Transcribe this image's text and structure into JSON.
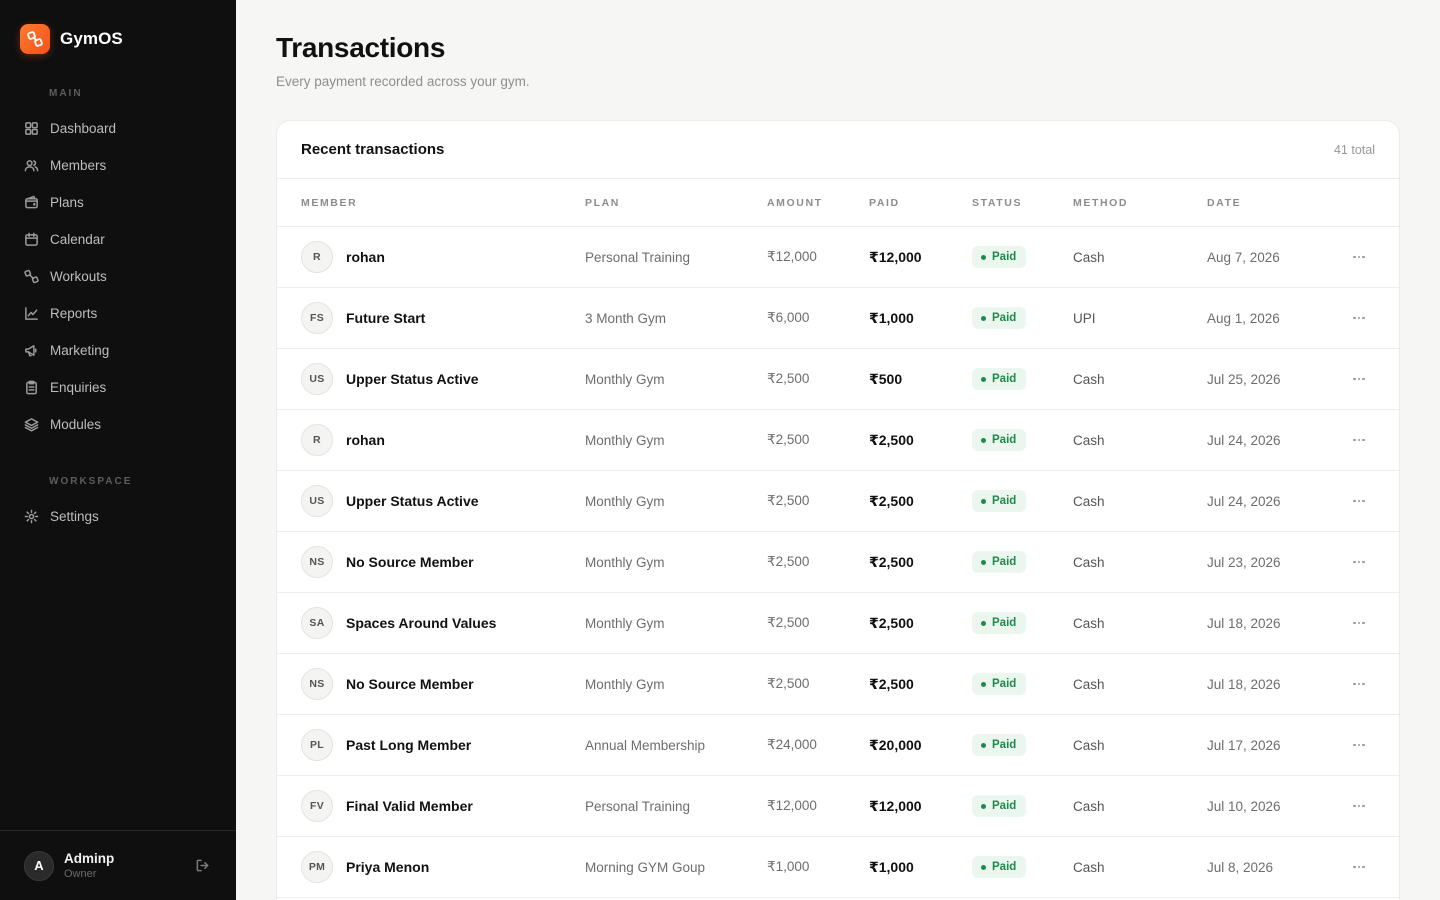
{
  "brand": {
    "name": "GymOS",
    "accent": "#f2541b"
  },
  "sidebar": {
    "sections": [
      {
        "label": "MAIN"
      },
      {
        "label": "WORKSPACE"
      }
    ],
    "items": [
      {
        "label": "Dashboard",
        "icon": "grid-icon"
      },
      {
        "label": "Members",
        "icon": "users-icon"
      },
      {
        "label": "Plans",
        "icon": "wallet-icon"
      },
      {
        "label": "Calendar",
        "icon": "calendar-icon"
      },
      {
        "label": "Workouts",
        "icon": "dumbbell-icon"
      },
      {
        "label": "Reports",
        "icon": "chart-line-icon"
      },
      {
        "label": "Marketing",
        "icon": "megaphone-icon"
      },
      {
        "label": "Enquiries",
        "icon": "clipboard-icon"
      },
      {
        "label": "Modules",
        "icon": "layers-icon"
      },
      {
        "label": "Settings",
        "icon": "gear-icon"
      }
    ],
    "user": {
      "initial": "A",
      "name": "Adminp",
      "role": "Owner"
    }
  },
  "page": {
    "title": "Transactions",
    "subtitle": "Every payment recorded across your gym."
  },
  "card": {
    "title": "Recent transactions",
    "count": "41 total"
  },
  "table": {
    "columns": [
      "MEMBER",
      "PLAN",
      "AMOUNT",
      "PAID",
      "STATUS",
      "METHOD",
      "DATE"
    ],
    "rows": [
      {
        "initials": "R",
        "member": "rohan",
        "plan": "Personal Training",
        "amount": "₹12,000",
        "paid": "₹12,000",
        "status": "Paid",
        "method": "Cash",
        "date": "Aug 7, 2026"
      },
      {
        "initials": "FS",
        "member": "Future Start",
        "plan": "3 Month Gym",
        "amount": "₹6,000",
        "paid": "₹1,000",
        "status": "Paid",
        "method": "UPI",
        "date": "Aug 1, 2026"
      },
      {
        "initials": "US",
        "member": "Upper Status Active",
        "plan": "Monthly Gym",
        "amount": "₹2,500",
        "paid": "₹500",
        "status": "Paid",
        "method": "Cash",
        "date": "Jul 25, 2026"
      },
      {
        "initials": "R",
        "member": "rohan",
        "plan": "Monthly Gym",
        "amount": "₹2,500",
        "paid": "₹2,500",
        "status": "Paid",
        "method": "Cash",
        "date": "Jul 24, 2026"
      },
      {
        "initials": "US",
        "member": "Upper Status Active",
        "plan": "Monthly Gym",
        "amount": "₹2,500",
        "paid": "₹2,500",
        "status": "Paid",
        "method": "Cash",
        "date": "Jul 24, 2026"
      },
      {
        "initials": "NS",
        "member": "No Source Member",
        "plan": "Monthly Gym",
        "amount": "₹2,500",
        "paid": "₹2,500",
        "status": "Paid",
        "method": "Cash",
        "date": "Jul 23, 2026"
      },
      {
        "initials": "SA",
        "member": "Spaces Around Values",
        "plan": "Monthly Gym",
        "amount": "₹2,500",
        "paid": "₹2,500",
        "status": "Paid",
        "method": "Cash",
        "date": "Jul 18, 2026"
      },
      {
        "initials": "NS",
        "member": "No Source Member",
        "plan": "Monthly Gym",
        "amount": "₹2,500",
        "paid": "₹2,500",
        "status": "Paid",
        "method": "Cash",
        "date": "Jul 18, 2026"
      },
      {
        "initials": "PL",
        "member": "Past Long Member",
        "plan": "Annual Membership",
        "amount": "₹24,000",
        "paid": "₹20,000",
        "status": "Paid",
        "method": "Cash",
        "date": "Jul 17, 2026"
      },
      {
        "initials": "FV",
        "member": "Final Valid Member",
        "plan": "Personal Training",
        "amount": "₹12,000",
        "paid": "₹12,000",
        "status": "Paid",
        "method": "Cash",
        "date": "Jul 10, 2026"
      },
      {
        "initials": "PM",
        "member": "Priya Menon",
        "plan": "Morning GYM Goup",
        "amount": "₹1,000",
        "paid": "₹1,000",
        "status": "Paid",
        "method": "Cash",
        "date": "Jul 8, 2026"
      }
    ]
  }
}
